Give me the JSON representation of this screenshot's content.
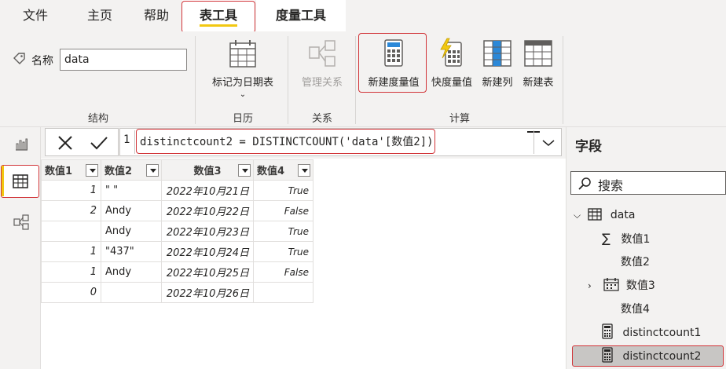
{
  "menu": {
    "tabs": [
      {
        "label": "文件"
      },
      {
        "label": "主页"
      },
      {
        "label": "帮助"
      },
      {
        "label": "表工具"
      },
      {
        "label": "度量工具"
      }
    ]
  },
  "ribbon": {
    "name_label": "名称",
    "name_value": "data",
    "groups": {
      "structure": "结构",
      "calendar": "日历",
      "relations": "关系",
      "compute": "计算"
    },
    "buttons": {
      "mark_date_table": "标记为日期表",
      "manage_relations": "管理关系",
      "new_measure": "新建度量值",
      "quick_measure": "快度量值",
      "new_column": "新建列",
      "new_table": "新建表"
    }
  },
  "formula": {
    "line_number": "1",
    "text": "distinctcount2 = DISTINCTCOUNT('data'[数值2])"
  },
  "table": {
    "columns": [
      "数值1",
      "数值2",
      "数值3",
      "数值4"
    ],
    "rows": [
      [
        "1",
        "\" \"",
        "2022年10月21日",
        "True"
      ],
      [
        "2",
        "Andy",
        "2022年10月22日",
        "False"
      ],
      [
        "",
        "Andy",
        "2022年10月23日",
        "True"
      ],
      [
        "1",
        "\"437\"",
        "2022年10月24日",
        "True"
      ],
      [
        "1",
        "Andy",
        "2022年10月25日",
        "False"
      ],
      [
        "0",
        "",
        "2022年10月26日",
        ""
      ]
    ]
  },
  "fields_pane": {
    "title": "字段",
    "search_placeholder": "搜索",
    "table_name": "data",
    "items": [
      {
        "label": "数值1",
        "icon": "sigma-icon"
      },
      {
        "label": "数值2",
        "icon": ""
      },
      {
        "label": "数值3",
        "icon": "calendar-icon"
      },
      {
        "label": "数值4",
        "icon": ""
      },
      {
        "label": "distinctcount1",
        "icon": "calculator-icon"
      },
      {
        "label": "distinctcount2",
        "icon": "calculator-icon"
      }
    ]
  },
  "colors": {
    "accent": "#f2c811",
    "highlight_border": "#d13438",
    "selected_bg": "#c8c6c4"
  }
}
